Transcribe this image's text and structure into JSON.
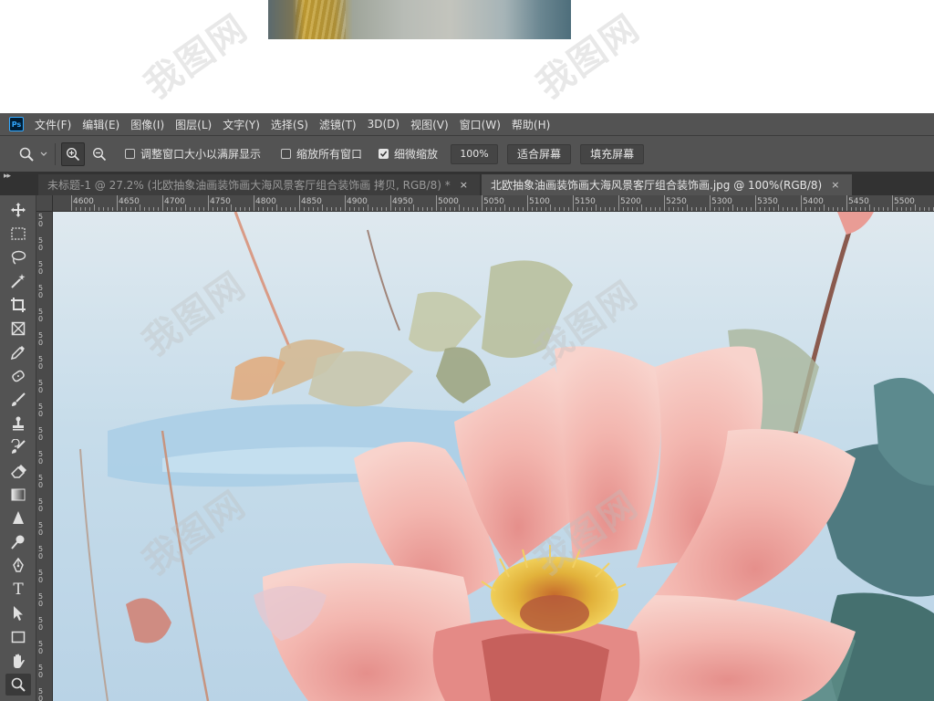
{
  "app": {
    "logo_text": "Ps",
    "menu": [
      "文件(F)",
      "编辑(E)",
      "图像(I)",
      "图层(L)",
      "文字(Y)",
      "选择(S)",
      "滤镜(T)",
      "3D(D)",
      "视图(V)",
      "窗口(W)",
      "帮助(H)"
    ]
  },
  "options": {
    "resize_windows_label": "调整窗口大小以满屏显示",
    "resize_windows_checked": false,
    "zoom_all_windows_label": "缩放所有窗口",
    "zoom_all_windows_checked": false,
    "scrubby_zoom_label": "细微缩放",
    "scrubby_zoom_checked": true,
    "zoom_percent": "100%",
    "fit_screen_label": "适合屏幕",
    "fill_screen_label": "填充屏幕"
  },
  "tabs": [
    {
      "title": "未标题-1 @ 27.2% (北欧抽象油画装饰画大海风景客厅组合装饰画 拷贝, RGB/8) *",
      "active": false
    },
    {
      "title": "北欧抽象油画装饰画大海风景客厅组合装饰画.jpg @ 100%(RGB/8)",
      "active": true
    }
  ],
  "tab_close_glyph": "×",
  "ruler": {
    "horizontal_labels": [
      "4600",
      "4650",
      "4700",
      "4750",
      "4800",
      "4850",
      "4900",
      "4950",
      "5000",
      "5050",
      "5100",
      "5150",
      "5200",
      "5250",
      "5300",
      "5350",
      "5400",
      "5450",
      "5500"
    ],
    "vertical_labels": [
      "5\n0",
      "5\n0",
      "5\n0",
      "5\n0",
      "5\n0",
      "5\n0",
      "5\n0",
      "5\n0",
      "5\n0",
      "5\n0",
      "5\n0",
      "5\n0",
      "5\n0",
      "5\n0",
      "5\n0",
      "5\n0",
      "5\n0",
      "5\n0",
      "5\n0",
      "5\n0",
      "5\n0"
    ]
  },
  "toolbar": {
    "tools": [
      "move-tool",
      "rectangular-marquee-tool",
      "lasso-tool",
      "magic-wand-tool",
      "crop-tool",
      "frame-tool",
      "eyedropper-tool",
      "healing-brush-tool",
      "brush-tool",
      "clone-stamp-tool",
      "history-brush-tool",
      "eraser-tool",
      "gradient-tool",
      "blur-tool",
      "dodge-tool",
      "pen-tool",
      "type-tool",
      "path-selection-tool",
      "rectangle-tool",
      "hand-tool",
      "zoom-tool"
    ],
    "selected": "zoom-tool",
    "type_tool_glyph": "T"
  },
  "colors": {
    "menubar_bg": "#535353",
    "panel_dark": "#323232",
    "ps_blue": "#31a8ff",
    "canvas_sky": "#cfe1ec",
    "petal_pink": "#f2b3ad",
    "teal_leaf": "#4f7a80"
  },
  "watermark_text": "我图网"
}
